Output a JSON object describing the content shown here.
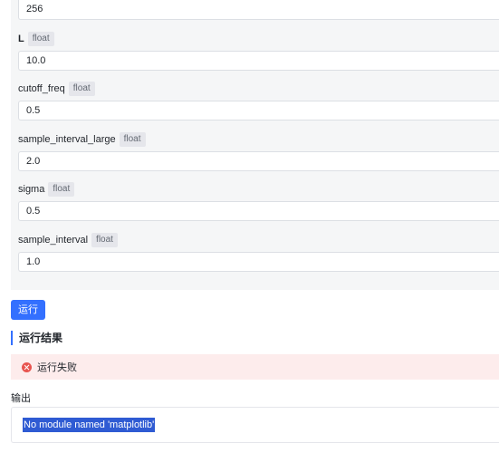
{
  "params": [
    {
      "value": "256"
    },
    {
      "name": "L",
      "type": "float",
      "value": "10.0"
    },
    {
      "name": "cutoff_freq",
      "type": "float",
      "value": "0.5"
    },
    {
      "name": "sample_interval_large",
      "type": "float",
      "value": "2.0"
    },
    {
      "name": "sigma",
      "type": "float",
      "value": "0.5"
    },
    {
      "name": "sample_interval",
      "type": "float",
      "value": "1.0"
    }
  ],
  "run_button_label": "运行",
  "result": {
    "title": "运行结果",
    "error_text": "运行失败",
    "output_label": "输出",
    "output_text": "No module named 'matplotlib'"
  },
  "colors": {
    "primary": "#3370ff",
    "error": "#e8544f",
    "error_bg": "#fdecec",
    "selection": "#2f5bd3"
  }
}
